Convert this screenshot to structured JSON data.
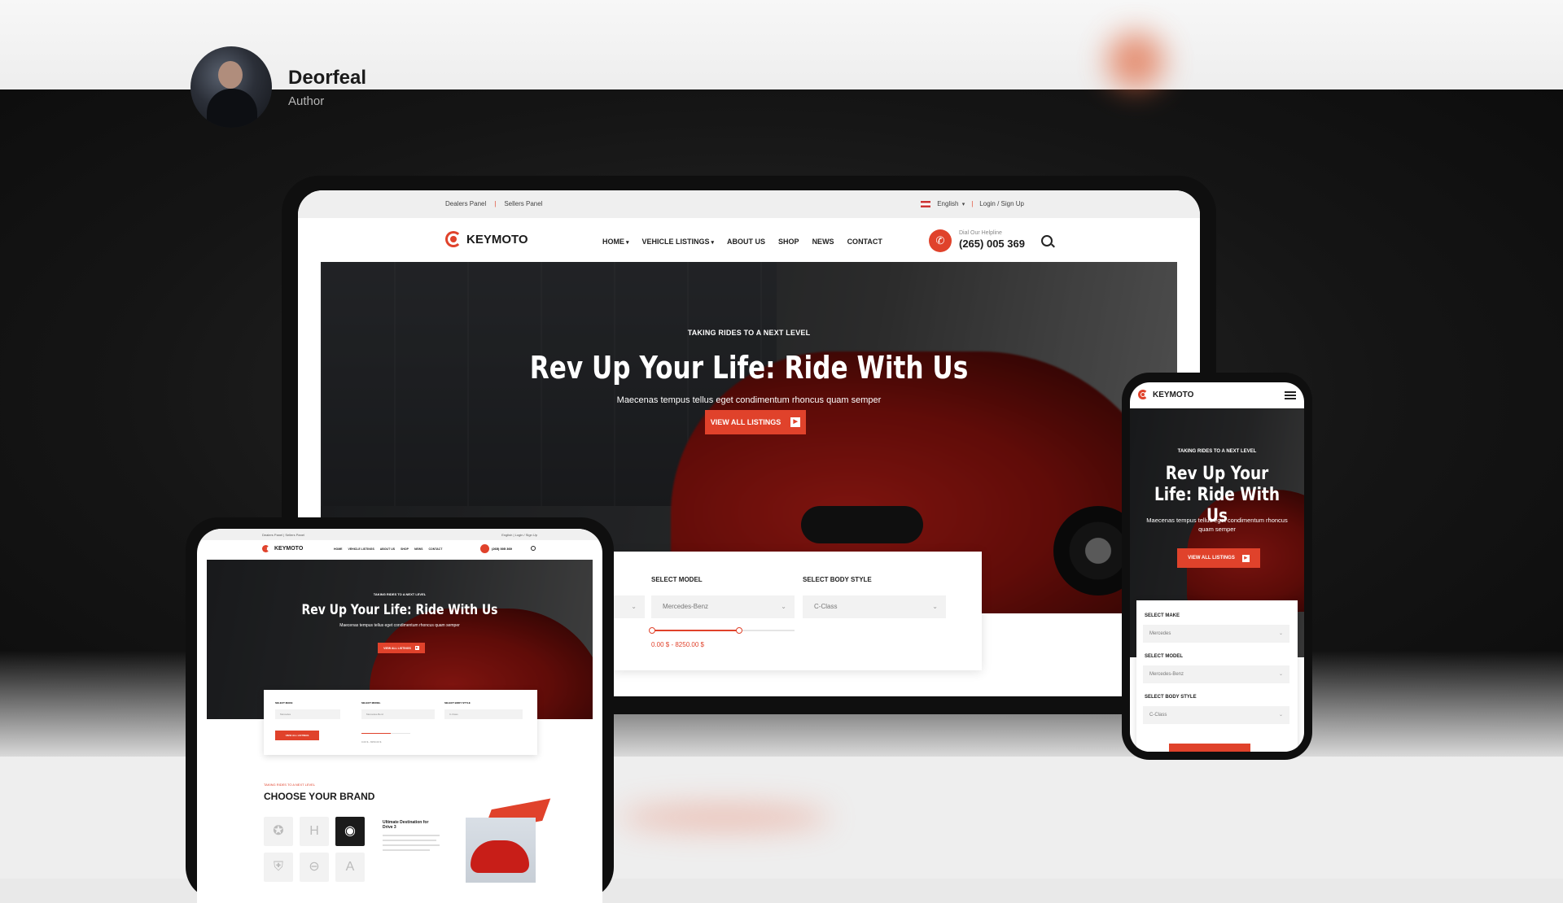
{
  "author": {
    "name": "Deorfeal",
    "role": "Author"
  },
  "colors": {
    "accent": "#e0422b",
    "dark": "#1b1b1b"
  },
  "desktop": {
    "topbar": {
      "dealers_panel": "Dealers Panel",
      "divider": "|",
      "sellers_panel": "Sellers Panel",
      "language": "English",
      "auth": "Login / Sign Up"
    },
    "logo": "KEYMOTO",
    "nav": [
      {
        "label": "HOME",
        "has_caret": true
      },
      {
        "label": "VEHICLE LISTINGS",
        "has_caret": true
      },
      {
        "label": "ABOUT US"
      },
      {
        "label": "SHOP"
      },
      {
        "label": "NEWS"
      },
      {
        "label": "CONTACT"
      }
    ],
    "helpline": {
      "label": "Dial Our Helpline",
      "number": "(265) 005 369"
    },
    "hero": {
      "eyebrow": "TAKING RIDES TO A NEXT LEVEL",
      "title": "Rev Up Your Life: Ride With Us",
      "subtitle": "Maecenas tempus tellus eget condimentum rhoncus quam semper",
      "cta": "VIEW ALL LISTINGS"
    },
    "search": {
      "model_label": "SELECT MODEL",
      "model_value": "Mercedes-Benz",
      "body_label": "SELECT BODY STYLE",
      "body_value": "C-Class",
      "price_range": "0.00 $ - 8250.00 $",
      "range_fraction": 0.61
    }
  },
  "tablet": {
    "topbar": {
      "left": "Dealers Panel | Sellers Panel",
      "right": "English | Login / Sign Up"
    },
    "logo": "KEYMOTO",
    "nav": [
      "HOME",
      "VEHICLE LISTINGS",
      "ABOUT US",
      "SHOP",
      "NEWS",
      "CONTACT"
    ],
    "helpline": "(265) 005 369",
    "hero": {
      "eyebrow": "TAKING RIDES TO A NEXT LEVEL",
      "title": "Rev Up Your Life: Ride With Us",
      "subtitle": "Maecenas tempus tellus eget condimentum rhoncus quam semper",
      "cta": "VIEW ALL LISTINGS"
    },
    "search": {
      "make_label": "SELECT MAKE",
      "make_value": "Mercedes",
      "model_label": "SELECT MODEL",
      "model_value": "Mercedes-Benz",
      "body_label": "SELECT BODY STYLE",
      "body_value": "C-Class",
      "cta": "VIEW ALL LISTINGS",
      "price_range": "0.00 $ - 8250.00 $"
    },
    "brands": {
      "eyebrow": "TAKING RIDES TO A NEXT LEVEL",
      "title": "CHOOSE YOUR BRAND",
      "promo_title": "Ultimate Destination for Drive 3",
      "icons": [
        "mercedes-icon",
        "honda-icon",
        "bmw-icon",
        "porsche-icon",
        "toyota-icon",
        "acura-icon"
      ]
    }
  },
  "phone": {
    "logo": "KEYMOTO",
    "hero": {
      "eyebrow": "TAKING RIDES TO A NEXT LEVEL",
      "title": "Rev Up Your Life: Ride With Us",
      "subtitle": "Maecenas tempus tellus eget condimentum rhoncus quam semper",
      "cta": "VIEW ALL LISTINGS"
    },
    "search": {
      "make_label": "SELECT MAKE",
      "make_value": "Mercedes",
      "model_label": "SELECT MODEL",
      "model_value": "Mercedes-Benz",
      "body_label": "SELECT BODY STYLE",
      "body_value": "C-Class"
    }
  }
}
